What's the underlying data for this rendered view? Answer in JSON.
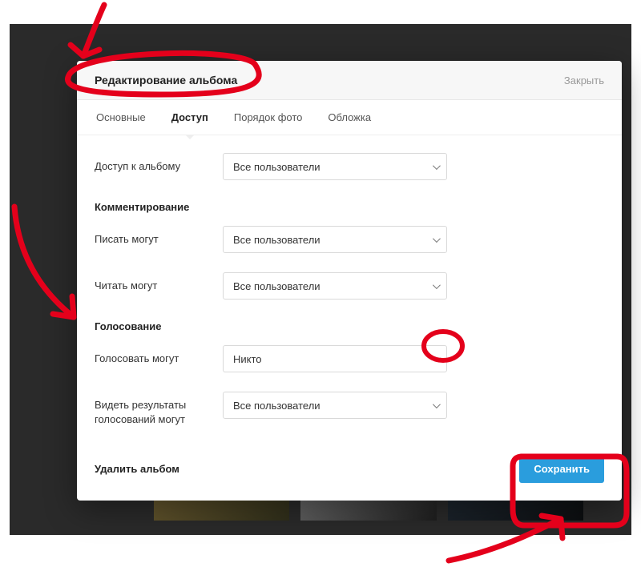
{
  "dialog": {
    "title": "Редактирование альбома",
    "close": "Закрыть"
  },
  "tabs": {
    "basic": "Основные",
    "access": "Доступ",
    "order": "Порядок фото",
    "cover": "Обложка",
    "active": "access"
  },
  "fields": {
    "album_access": {
      "label": "Доступ к альбому",
      "value": "Все пользователи"
    },
    "commenting_heading": "Комментирование",
    "write": {
      "label": "Писать могут",
      "value": "Все пользователи"
    },
    "read": {
      "label": "Читать могут",
      "value": "Все пользователи"
    },
    "voting_heading": "Голосование",
    "vote": {
      "label": "Голосовать могут",
      "value": "Никто"
    },
    "results": {
      "label": "Видеть результаты голосований могут",
      "value": "Все пользователи"
    }
  },
  "footer": {
    "delete": "Удалить альбом",
    "save": "Сохранить"
  }
}
